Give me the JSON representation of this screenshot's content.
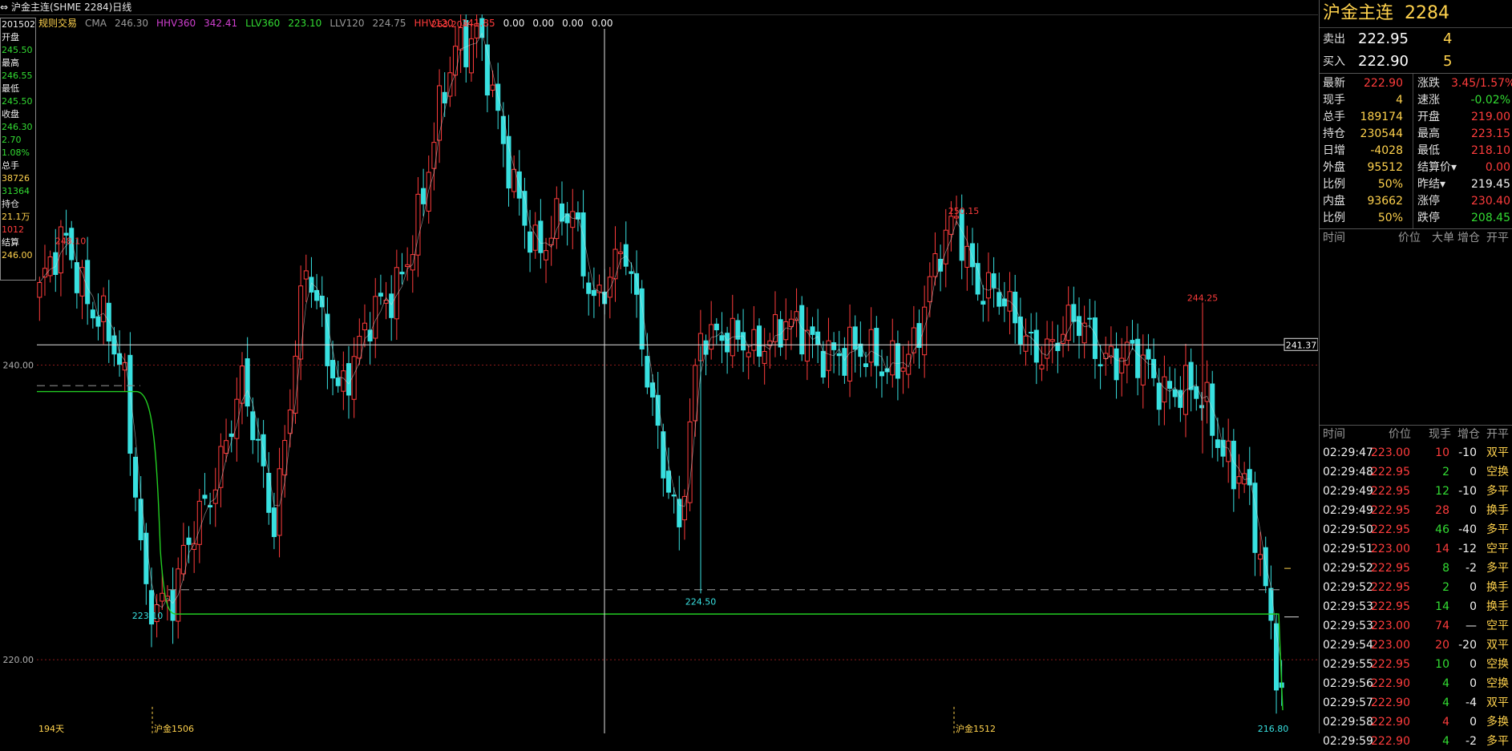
{
  "window": {
    "title": "沪金主连(SHME 2284)日线"
  },
  "indicators": [
    {
      "label": "规则交易",
      "color": "#ffd24d"
    },
    {
      "label": "CMA",
      "color": "#9a9a9a"
    },
    {
      "label": "246.30",
      "color": "#9a9a9a"
    },
    {
      "label": "HHV360",
      "color": "#d040d0"
    },
    {
      "label": "342.41",
      "color": "#d040d0"
    },
    {
      "label": "LLV360",
      "color": "#33dd33"
    },
    {
      "label": "223.10",
      "color": "#33dd33"
    },
    {
      "label": "LLV120",
      "color": "#9a9a9a"
    },
    {
      "label": "224.75",
      "color": "#9a9a9a"
    },
    {
      "label": "HHV120",
      "color": "#ff3c3c"
    },
    {
      "label": "341.85",
      "color": "#ff3c3c"
    },
    {
      "label": "0.00",
      "color": "#f0f0f0"
    },
    {
      "label": "0.00",
      "color": "#f0f0f0"
    },
    {
      "label": "0.00",
      "color": "#f0f0f0"
    },
    {
      "label": "0.00",
      "color": "#f0f0f0"
    }
  ],
  "info_box": [
    {
      "t": "20150225",
      "c": "#f0f0f0"
    },
    {
      "t": "开盘",
      "c": "#f0f0f0"
    },
    {
      "t": "245.50",
      "c": "#33dd33"
    },
    {
      "t": "最高",
      "c": "#f0f0f0"
    },
    {
      "t": "246.55",
      "c": "#33dd33"
    },
    {
      "t": "最低",
      "c": "#f0f0f0"
    },
    {
      "t": "245.50",
      "c": "#33dd33"
    },
    {
      "t": "收盘",
      "c": "#f0f0f0"
    },
    {
      "t": "246.30",
      "c": "#33dd33"
    },
    {
      "t": "2.70",
      "c": "#33dd33"
    },
    {
      "t": "1.08%",
      "c": "#33dd33"
    },
    {
      "t": "总手",
      "c": "#f0f0f0"
    },
    {
      "t": "38726",
      "c": "#ffd24d"
    },
    {
      "t": "31364",
      "c": "#33dd33"
    },
    {
      "t": "持仓",
      "c": "#f0f0f0"
    },
    {
      "t": "21.1万",
      "c": "#ffd24d"
    },
    {
      "t": "1012",
      "c": "#ff3c3c"
    },
    {
      "t": "结算",
      "c": "#f0f0f0"
    },
    {
      "t": "246.00",
      "c": "#ffd24d"
    }
  ],
  "chart_data": {
    "type": "candlestick",
    "ylim": [
      215.0,
      263.8
    ],
    "y_ticks": [
      "240.00",
      "220.00"
    ],
    "price_tags": {
      "crosshair": "241.37"
    },
    "labels": {
      "high_1": "248.10",
      "peak": "263.20",
      "low_1": "223.10",
      "low_2": "224.50",
      "high_2": "250.15",
      "spike": "244.25",
      "last_low": "216.80",
      "days": "194天",
      "contract_1": "沪金1506",
      "contract_2": "沪金1512"
    },
    "levels": {
      "lower_dashed": 224.75,
      "upper_dashed": 238.6,
      "llv": 223.1
    },
    "anchors": [
      [
        0,
        245
      ],
      [
        5,
        248.1
      ],
      [
        12,
        243
      ],
      [
        16,
        238
      ],
      [
        20,
        225
      ],
      [
        25,
        223.5
      ],
      [
        30,
        230
      ],
      [
        38,
        238
      ],
      [
        44,
        230
      ],
      [
        50,
        246
      ],
      [
        56,
        239
      ],
      [
        60,
        241
      ],
      [
        66,
        245
      ],
      [
        72,
        251
      ],
      [
        78,
        262
      ],
      [
        82,
        263.2
      ],
      [
        87,
        254
      ],
      [
        94,
        248
      ],
      [
        100,
        250
      ],
      [
        104,
        245
      ],
      [
        110,
        247
      ],
      [
        114,
        240
      ],
      [
        120,
        228
      ],
      [
        124,
        242
      ],
      [
        128,
        243
      ],
      [
        134,
        240
      ],
      [
        140,
        244
      ],
      [
        146,
        240
      ],
      [
        152,
        242
      ],
      [
        158,
        239
      ],
      [
        164,
        242
      ],
      [
        172,
        250
      ],
      [
        176,
        246
      ],
      [
        182,
        243
      ],
      [
        190,
        241
      ],
      [
        196,
        243
      ],
      [
        202,
        240
      ],
      [
        208,
        240
      ],
      [
        214,
        238
      ],
      [
        219,
        237
      ],
      [
        226,
        232
      ],
      [
        230,
        224
      ],
      [
        233,
        218
      ],
      [
        234,
        216.8
      ]
    ]
  },
  "right_panel": {
    "name": "沪金主连",
    "code": "2284",
    "sell": {
      "label": "卖出",
      "price": "222.95",
      "vol": "4"
    },
    "buy": {
      "label": "买入",
      "price": "222.90",
      "vol": "5"
    },
    "quote": [
      {
        "k1": "最新",
        "v1": "222.90",
        "c1": "#ff3c3c",
        "k2": "涨跌",
        "v2": "3.45/1.57%",
        "c2": "#ff3c3c"
      },
      {
        "k1": "现手",
        "v1": "4",
        "c1": "#ffd24d",
        "k2": "速涨",
        "v2": "-0.02%",
        "c2": "#33dd33"
      },
      {
        "k1": "总手",
        "v1": "189174",
        "c1": "#ffd24d",
        "k2": "开盘",
        "v2": "219.00",
        "c2": "#ff3c3c"
      },
      {
        "k1": "持仓",
        "v1": "230544",
        "c1": "#ffd24d",
        "k2": "最高",
        "v2": "223.15",
        "c2": "#ff3c3c"
      },
      {
        "k1": "日增",
        "v1": "-4028",
        "c1": "#ffd24d",
        "k2": "最低",
        "v2": "218.10",
        "c2": "#ff3c3c"
      },
      {
        "k1": "外盘",
        "v1": "95512",
        "c1": "#ffd24d",
        "k2": "结算价▾",
        "v2": "0.00",
        "c2": "#ff3c3c"
      },
      {
        "k1": "比例",
        "v1": "50%",
        "c1": "#ffd24d",
        "k2": "昨结▾",
        "v2": "219.45",
        "c2": "#f0f0f0"
      },
      {
        "k1": "内盘",
        "v1": "93662",
        "c1": "#ffd24d",
        "k2": "涨停",
        "v2": "230.40",
        "c2": "#ff3c3c"
      },
      {
        "k1": "比例",
        "v1": "50%",
        "c1": "#ffd24d",
        "k2": "跌停",
        "v2": "208.45",
        "c2": "#33dd33"
      }
    ],
    "big_header": {
      "time": "时间",
      "price": "价位",
      "big": "大单",
      "inc": "增仓",
      "oc": "开平"
    },
    "tick_header": {
      "time": "时间",
      "price": "价位",
      "vol": "现手",
      "inc": "增仓",
      "oc": "开平"
    },
    "ticks": [
      {
        "t": "02:29:47",
        "p": "223.00",
        "v": "10",
        "vc": "#ff3c3c",
        "i": "-10",
        "o": "双平"
      },
      {
        "t": "02:29:48",
        "p": "222.95",
        "v": "2",
        "vc": "#33dd33",
        "i": "0",
        "o": "空换"
      },
      {
        "t": "02:29:49",
        "p": "222.95",
        "v": "12",
        "vc": "#33dd33",
        "i": "-10",
        "o": "多平"
      },
      {
        "t": "02:29:49",
        "p": "222.95",
        "v": "28",
        "vc": "#ff3c3c",
        "i": "0",
        "o": "换手"
      },
      {
        "t": "02:29:50",
        "p": "222.95",
        "v": "46",
        "vc": "#33dd33",
        "i": "-40",
        "o": "多平"
      },
      {
        "t": "02:29:51",
        "p": "223.00",
        "v": "14",
        "vc": "#ff3c3c",
        "i": "-12",
        "o": "空平"
      },
      {
        "t": "02:29:52",
        "p": "222.95",
        "v": "8",
        "vc": "#33dd33",
        "i": "-2",
        "o": "多平"
      },
      {
        "t": "02:29:52",
        "p": "222.95",
        "v": "2",
        "vc": "#33dd33",
        "i": "0",
        "o": "换手"
      },
      {
        "t": "02:29:53",
        "p": "222.95",
        "v": "14",
        "vc": "#33dd33",
        "i": "0",
        "o": "换手"
      },
      {
        "t": "02:29:53",
        "p": "223.00",
        "v": "74",
        "vc": "#ff3c3c",
        "i": "—",
        "o": "空平"
      },
      {
        "t": "02:29:54",
        "p": "223.00",
        "v": "20",
        "vc": "#ff3c3c",
        "i": "-20",
        "o": "双平"
      },
      {
        "t": "02:29:55",
        "p": "222.95",
        "v": "10",
        "vc": "#33dd33",
        "i": "0",
        "o": "空换"
      },
      {
        "t": "02:29:56",
        "p": "222.90",
        "v": "4",
        "vc": "#33dd33",
        "i": "0",
        "o": "空换"
      },
      {
        "t": "02:29:57",
        "p": "222.90",
        "v": "4",
        "vc": "#33dd33",
        "i": "-4",
        "o": "双平"
      },
      {
        "t": "02:29:58",
        "p": "222.90",
        "v": "4",
        "vc": "#ff3c3c",
        "i": "0",
        "o": "多换"
      },
      {
        "t": "02:29:59",
        "p": "222.90",
        "v": "4",
        "vc": "#33dd33",
        "i": "-2",
        "o": "多平"
      }
    ]
  }
}
